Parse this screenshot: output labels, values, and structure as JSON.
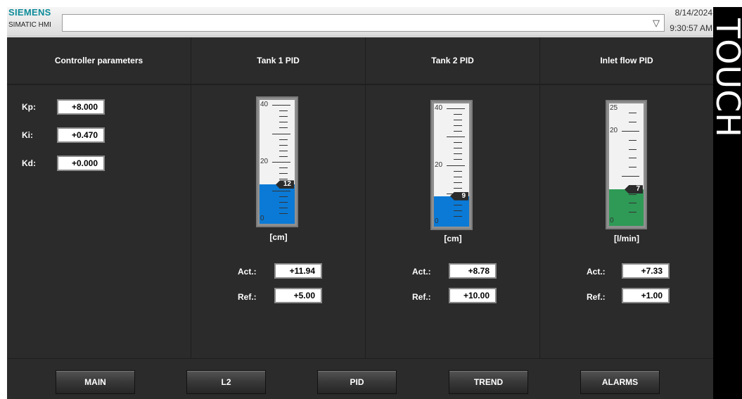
{
  "header": {
    "brand": "SIEMENS",
    "product": "SIMATIC HMI",
    "alarm_dropdown_icon": "triangle-down-icon",
    "date": "8/14/2024",
    "time": "9:30:57 AM"
  },
  "bezel_text": "TOUCH",
  "columns": {
    "controller_params": "Controller parameters",
    "tank1": "Tank 1 PID",
    "tank2": "Tank 2 PID",
    "inlet": "Inlet flow PID"
  },
  "params": [
    {
      "label": "Kp:",
      "value": "+8.000"
    },
    {
      "label": "Ki:",
      "value": "+0.470"
    },
    {
      "label": "Kd:",
      "value": "+0.000"
    }
  ],
  "gauges": [
    {
      "id": "tank1",
      "max": 40,
      "ticks": [
        "40",
        "20",
        "0"
      ],
      "value": 12,
      "marker": "12",
      "unit": "[cm]",
      "fill_color": "#0a7ad6",
      "act_label": "Act.:",
      "act": "+11.94",
      "ref_label": "Ref.:",
      "ref": "+5.00"
    },
    {
      "id": "tank2",
      "max": 40,
      "ticks": [
        "40",
        "20",
        "0"
      ],
      "value": 9,
      "marker": "9",
      "unit": "[cm]",
      "fill_color": "#0a7ad6",
      "act_label": "Act.:",
      "act": "+8.78",
      "ref_label": "Ref.:",
      "ref": "+10.00"
    },
    {
      "id": "inlet",
      "max": 25,
      "ticks": [
        "25",
        "20",
        "0"
      ],
      "value": 7,
      "marker": "7",
      "unit": "[l/min]",
      "fill_color": "#2e9a56",
      "act_label": "Act.:",
      "act": "+7.33",
      "ref_label": "Ref.:",
      "ref": "+1.00"
    }
  ],
  "nav": [
    "MAIN",
    "L2",
    "PID",
    "TREND",
    "ALARMS"
  ]
}
